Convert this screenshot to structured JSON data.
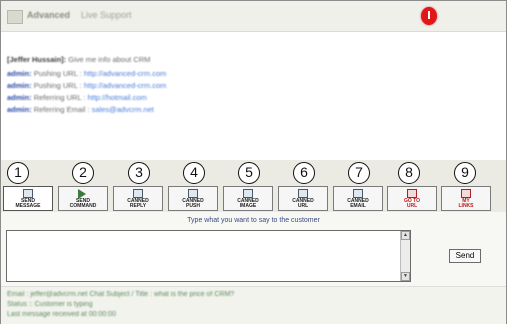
{
  "window": {
    "title": "Advanced",
    "subtitle": "Live Support"
  },
  "transcript": [
    {
      "who": "[Jeffer Hussain]:",
      "text": "Give me info about CRM",
      "link": ""
    },
    {
      "who": "admin:",
      "text": "Pushing URL : ",
      "link": "http://advanced-crm.com"
    },
    {
      "who": "admin:",
      "text": "Pushing URL : ",
      "link": "http://advanced-crm.com"
    },
    {
      "who": "admin:",
      "text": "Referring URL : ",
      "link": "http://hotmail.com"
    },
    {
      "who": "admin:",
      "text": "Referring Email : ",
      "link": "sales@advcrm.net"
    }
  ],
  "toolbar": [
    {
      "num": "1",
      "label_1": "SEND",
      "label_2": "MESSAGE",
      "icon": "send-message-icon",
      "active": true
    },
    {
      "num": "2",
      "label_1": "SEND",
      "label_2": "COMMAND",
      "icon": "send-command-icon",
      "active": false
    },
    {
      "num": "3",
      "label_1": "CANNED",
      "label_2": "REPLY",
      "icon": "canned-reply-icon",
      "active": false
    },
    {
      "num": "4",
      "label_1": "CANNED",
      "label_2": "PUSH",
      "icon": "canned-push-icon",
      "active": false
    },
    {
      "num": "5",
      "label_1": "CANNED",
      "label_2": "IMAGE",
      "icon": "canned-image-icon",
      "active": false
    },
    {
      "num": "6",
      "label_1": "CANNED",
      "label_2": "URL",
      "icon": "canned-url-icon",
      "active": false
    },
    {
      "num": "7",
      "label_1": "CANNED",
      "label_2": "EMAIL",
      "icon": "canned-email-icon",
      "active": false
    },
    {
      "num": "8",
      "label_1": "GO TO",
      "label_2": "URL",
      "icon": "go-to-url-icon",
      "active": false
    },
    {
      "num": "9",
      "label_1": "MY",
      "label_2": "LINKS",
      "icon": "my-links-icon",
      "active": false
    }
  ],
  "compose": {
    "hint": "Type what you want to say to the customer",
    "value": "",
    "send_label": "Send"
  },
  "status": [
    "Email : jeffer@advcrm.net     Chat Subject / Title : what is the price of CRM?",
    "Status :: Customer is typing",
    "Last message received at 00:00:00"
  ]
}
